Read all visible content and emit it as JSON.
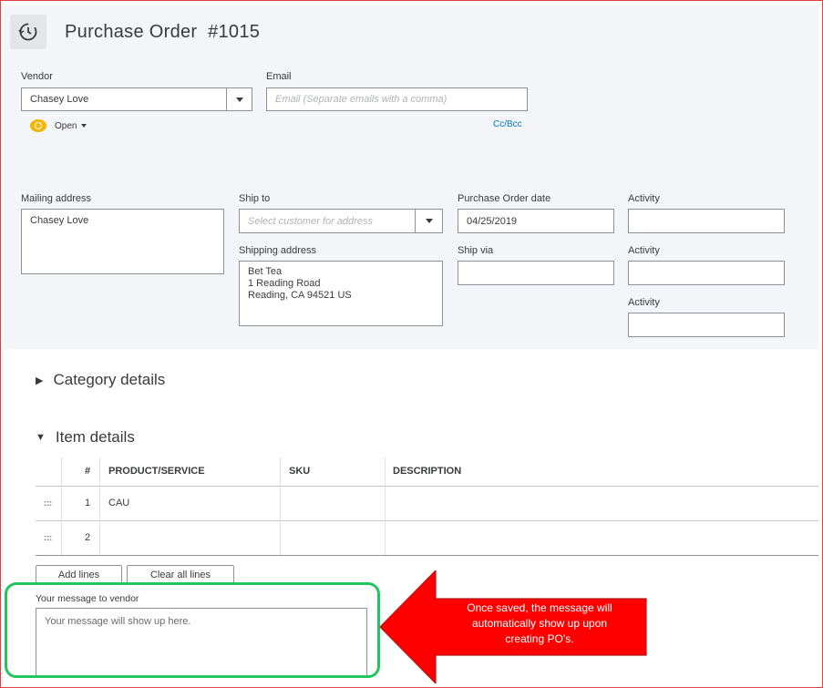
{
  "header": {
    "title": "Purchase Order  #1015"
  },
  "vendor": {
    "label": "Vendor",
    "value": "Chasey Love"
  },
  "email": {
    "label": "Email",
    "placeholder": "Email (Separate emails with a comma)",
    "cc_bcc": "Cc/Bcc"
  },
  "status": {
    "label": "Open"
  },
  "mailing_address": {
    "label": "Mailing address",
    "value": "Chasey Love"
  },
  "ship_to": {
    "label": "Ship to",
    "placeholder": "Select customer for address"
  },
  "shipping_address": {
    "label": "Shipping address",
    "lines": [
      "Bet Tea",
      "1 Reading Road",
      "Reading, CA  94521 US"
    ]
  },
  "po_date": {
    "label": "Purchase Order date",
    "value": "04/25/2019"
  },
  "ship_via": {
    "label": "Ship via",
    "value": ""
  },
  "activity": {
    "labels": [
      "Activity",
      "Activity",
      "Activity"
    ]
  },
  "category_details": {
    "label": "Category details",
    "collapsed_icon": "triangle-right-icon"
  },
  "item_details": {
    "label": "Item details",
    "expanded_icon": "triangle-down-icon",
    "columns": [
      "#",
      "PRODUCT/SERVICE",
      "SKU",
      "DESCRIPTION"
    ],
    "rows": [
      {
        "num": "1",
        "product": "CAU",
        "sku": "",
        "description": ""
      },
      {
        "num": "2",
        "product": "",
        "sku": "",
        "description": ""
      }
    ],
    "add_lines": "Add lines",
    "clear_lines": "Clear all lines"
  },
  "message": {
    "label": "Your message to vendor",
    "value": "Your message will show up here."
  },
  "callout": {
    "lines": [
      "Once saved, the message will",
      "automatically show up upon",
      "creating PO’s."
    ]
  },
  "colors": {
    "accent_green": "#22c55e",
    "callout_red": "#ff0000",
    "link_blue": "#0077c5",
    "status_yellow": "#f2b705"
  }
}
